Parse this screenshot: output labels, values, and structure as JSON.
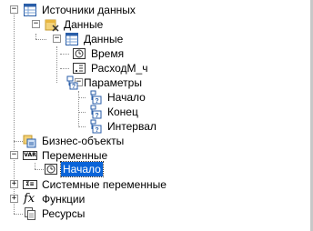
{
  "tree": {
    "data_sources": "Источники данных",
    "data": "Данные",
    "dataset": "Данные",
    "field_time": "Время",
    "field_flow": "РасходМ_ч",
    "parameters": "Параметры",
    "param_start": "Начало",
    "param_end": "Конец",
    "param_interval": "Интервал",
    "business_objects": "Бизнес-объекты",
    "variables": "Переменные",
    "var_start": "Начало",
    "system_variables": "Системные переменные",
    "functions": "Функции",
    "resources": "Ресурсы"
  },
  "glyphs": {
    "minus": "−",
    "plus": "+",
    "fx": "fx",
    "var_badge": "VAR",
    "sys_badge": "Σ≡",
    "field_a": "A",
    "param_q": "?"
  },
  "colors": {
    "selection": "#0a64d8",
    "tree_lines": "#8f8f8f",
    "icon_blue": "#2a5ea8",
    "icon_yellow": "#e8b640"
  }
}
